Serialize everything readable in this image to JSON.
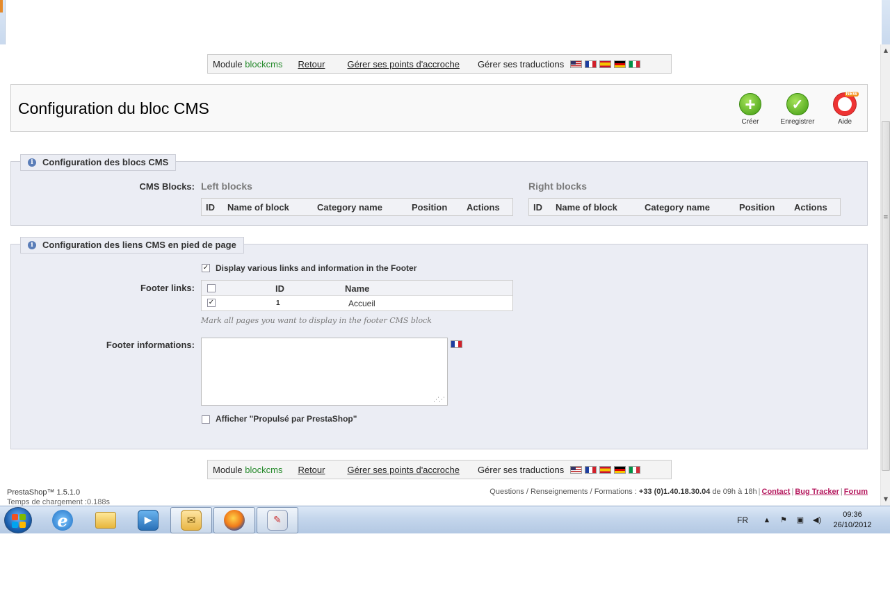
{
  "module_bar": {
    "module_label": "Module",
    "module_name": "blockcms",
    "back_label": "Retour",
    "hooks_label": "Gérer ses points d'accroche",
    "translations_label": "Gérer ses traductions",
    "flags": [
      "en",
      "fr",
      "es",
      "de",
      "it"
    ]
  },
  "header": {
    "title": "Configuration du bloc CMS",
    "toolbar": {
      "create_label": "Créer",
      "save_label": "Enregistrer",
      "help_label": "Aide"
    }
  },
  "cms_blocks_section": {
    "legend": "Configuration des blocs CMS",
    "field_label": "CMS Blocks:",
    "left_title": "Left blocks",
    "right_title": "Right blocks",
    "columns": [
      "ID",
      "Name of block",
      "Category name",
      "Position",
      "Actions"
    ]
  },
  "footer_section": {
    "legend": "Configuration des liens CMS en pied de page",
    "display_links_label": "Display various links and information in the Footer",
    "display_links_checked": true,
    "footer_links_label": "Footer links:",
    "links_columns": {
      "id": "ID",
      "name": "Name"
    },
    "links_rows": [
      {
        "id": "1",
        "name": "Accueil",
        "checked": true
      }
    ],
    "links_hint": "Mark all pages you want to display in the footer CMS block",
    "footer_info_label": "Footer informations:",
    "footer_info_value": "",
    "powered_by_label": "Afficher \"Propulsé par PrestaShop\"",
    "powered_by_checked": false
  },
  "page_footer": {
    "version": "PrestaShop™ 1.5.1.0",
    "load_time": "Temps de chargement :0.188s",
    "contact_text": "Questions / Renseignements / Formations :",
    "phone": "+33 (0)1.40.18.30.04",
    "hours": "de 09h à 18h",
    "links": [
      "Contact",
      "Bug Tracker",
      "Forum"
    ]
  },
  "taskbar": {
    "language": "FR",
    "time": "09:36",
    "date": "26/10/2012"
  },
  "colors": {
    "module_name": "#268a2c",
    "footer_link": "#b5195e",
    "fieldset_bg": "#ebedf4"
  }
}
